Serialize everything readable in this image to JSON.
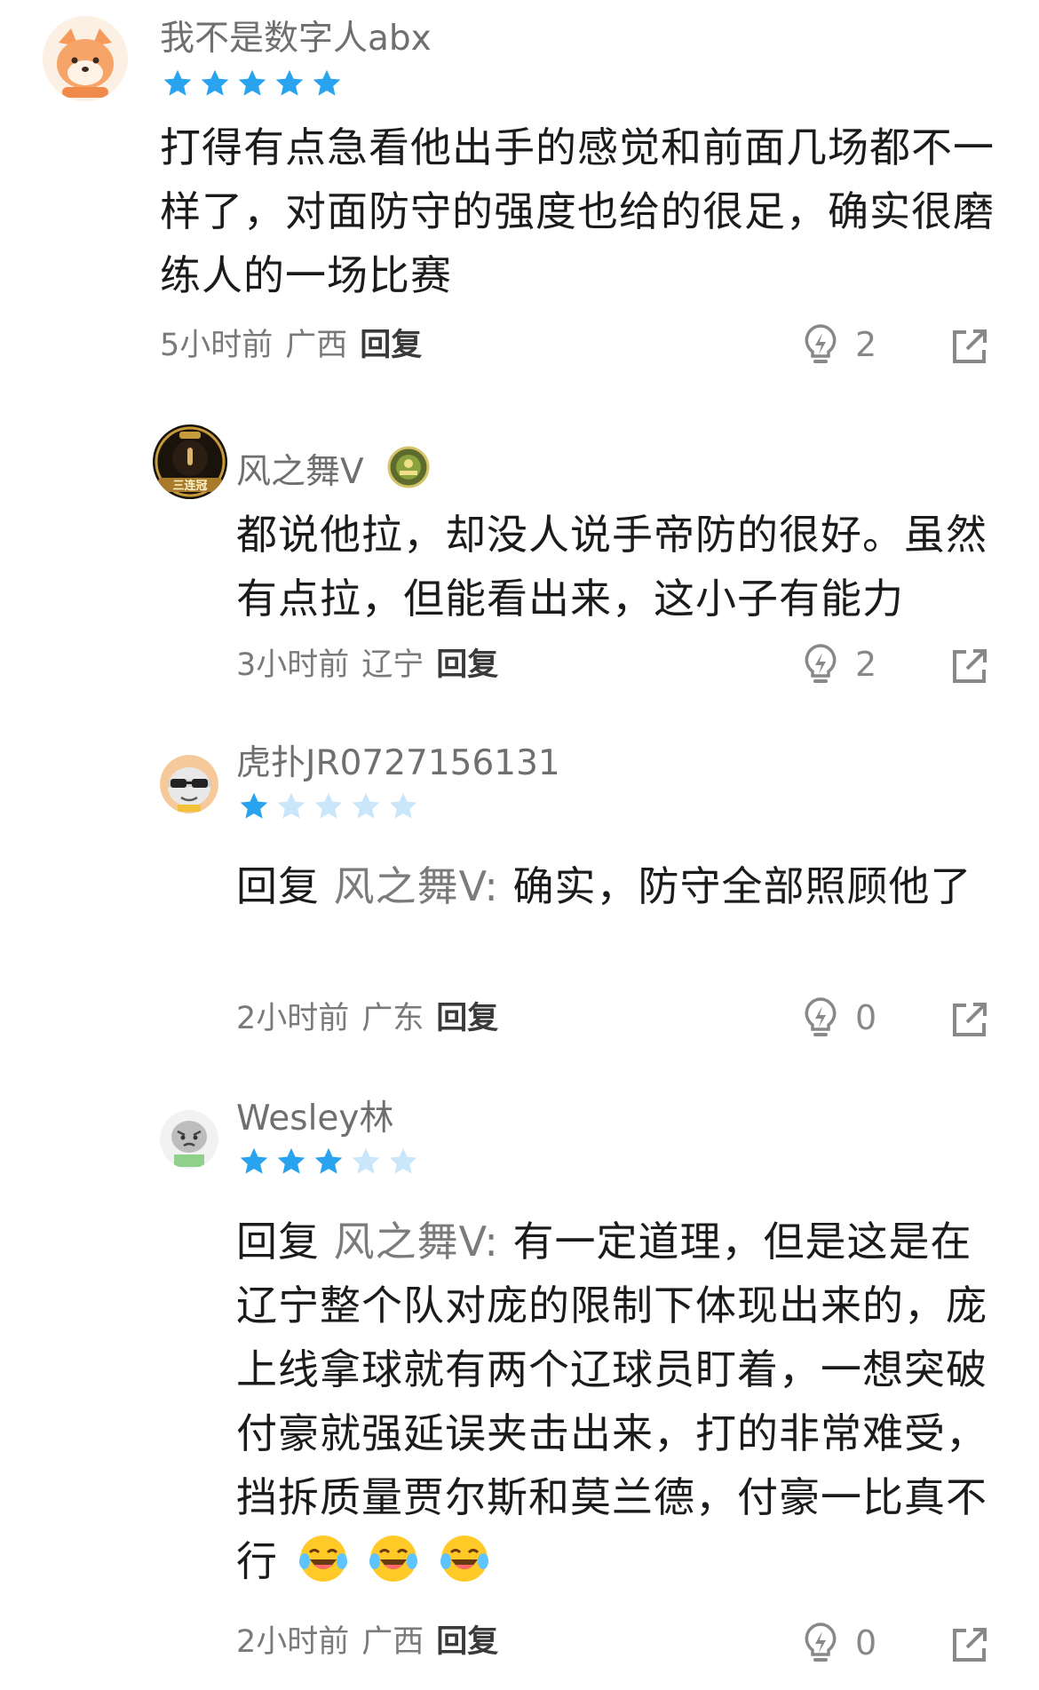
{
  "comments": [
    {
      "username": "我不是数字人abx",
      "rating": 5,
      "text": "打得有点急看他出手的感觉和前面几场都不一样了，对面防守的强度也给的很足，确实很磨练人的一场比赛",
      "time": "5小时前",
      "location": "广西",
      "reply_label": "回复",
      "likes": "2",
      "avatar_icon": "fox-avatar-icon"
    },
    {
      "username": "风之舞V",
      "badge_icon": "team-badge-icon",
      "avatar_icon": "three-championship-avatar-icon",
      "avatar_text": "三连冠",
      "text": "都说他拉，却没人说手帝防的很好。虽然有点拉，但能看出来，这小子有能力",
      "time": "3小时前",
      "location": "辽宁",
      "reply_label": "回复",
      "likes": "2"
    },
    {
      "username": "虎扑JR0727156131",
      "rating": 1,
      "avatar_icon": "sunglasses-avatar-icon",
      "reply_prefix": "回复",
      "reply_target": "风之舞V:",
      "text": "确实，防守全部照顾他了",
      "time": "2小时前",
      "location": "广东",
      "reply_label": "回复",
      "likes": "0"
    },
    {
      "username": "Wesley林",
      "rating": 3,
      "avatar_icon": "grumpy-avatar-icon",
      "reply_prefix": "回复",
      "reply_target": "风之舞V:",
      "text": "有一定道理，但是这是在辽宁整个队对庞的限制下体现出来的，庞上线拿球就有两个辽球员盯着，一想突破付豪就强延误夹击出来，打的非常难受，挡拆质量贾尔斯和莫兰德，付豪一比真不行",
      "emoji": [
        "laughing-tears-emoji",
        "laughing-tears-emoji",
        "laughing-tears-emoji"
      ],
      "time": "2小时前",
      "location": "广西",
      "reply_label": "回复",
      "likes": "0"
    }
  ],
  "colors": {
    "star_on": "#2aa3ee",
    "star_off": "#c9e6fb",
    "meta": "#7a7a7a",
    "name": "#6f6f6f"
  }
}
